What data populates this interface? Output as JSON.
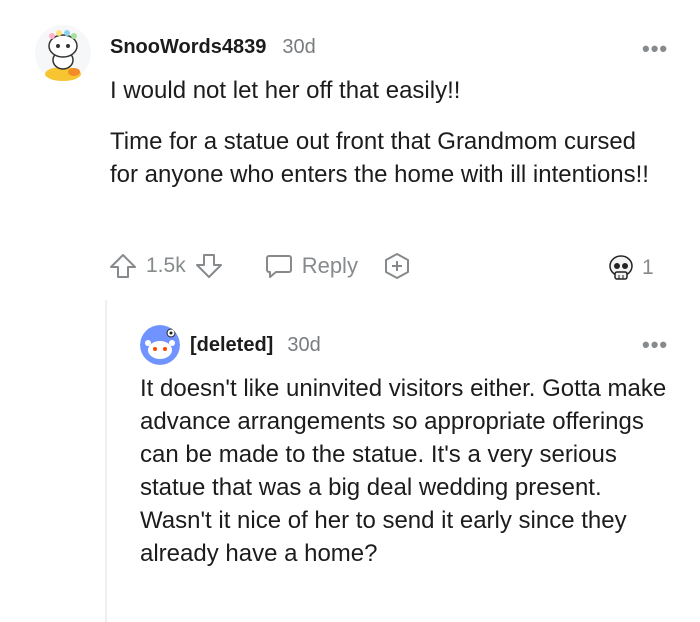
{
  "comment": {
    "username": "SnooWords4839",
    "age": "30d",
    "paragraphs": [
      "I would not let her off that easily!!",
      "Time for a statue out front that Grandmom cursed for anyone who enters the home with ill intentions!!"
    ],
    "upvotes": "1.5k",
    "reply_label": "Reply",
    "award_count": "1",
    "more_label": "•••"
  },
  "reply": {
    "username": "[deleted]",
    "age": "30d",
    "text": "It doesn't like uninvited visitors either. Gotta make advance arrangements so appropriate offerings can be made to the statue. It's a very serious statue that was a big deal wedding present. Wasn't it nice of her to send it early since they already have a home?",
    "more_label": "•••"
  },
  "icons": {
    "upvote": "arrow-up-icon",
    "downvote": "arrow-down-icon",
    "reply": "chat-bubble-icon",
    "award": "plus-circle-icon",
    "award_badge": "skull-award-icon"
  }
}
